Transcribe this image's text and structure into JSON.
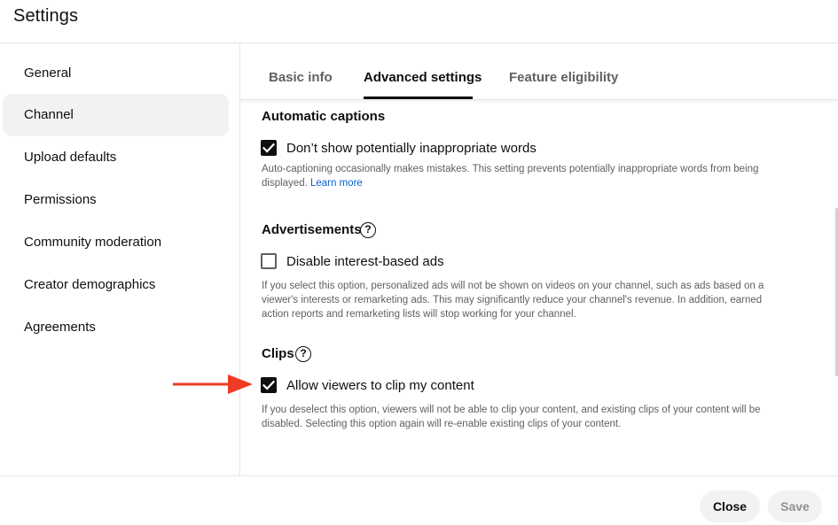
{
  "header": {
    "title": "Settings"
  },
  "sidebar": {
    "items": [
      {
        "label": "General",
        "active": false
      },
      {
        "label": "Channel",
        "active": true
      },
      {
        "label": "Upload defaults",
        "active": false
      },
      {
        "label": "Permissions",
        "active": false
      },
      {
        "label": "Community moderation",
        "active": false
      },
      {
        "label": "Creator demographics",
        "active": false
      },
      {
        "label": "Agreements",
        "active": false
      }
    ]
  },
  "tabs": [
    {
      "label": "Basic info",
      "active": false
    },
    {
      "label": "Advanced settings",
      "active": true
    },
    {
      "label": "Feature eligibility",
      "active": false
    }
  ],
  "captions": {
    "title": "Automatic captions",
    "checkbox_label": "Don’t show potentially inappropriate words",
    "checked": true,
    "description": "Auto-captioning occasionally makes mistakes. This setting prevents potentially inappropriate words from being displayed.",
    "learn_more": "Learn more"
  },
  "ads": {
    "title": "Advertisements",
    "checkbox_label": "Disable interest-based ads",
    "checked": false,
    "description": "If you select this option, personalized ads will not be shown on videos on your channel, such as ads based on a viewer's interests or remarketing ads. This may significantly reduce your channel's revenue. In addition, earned action reports and remarketing lists will stop working for your channel."
  },
  "clips": {
    "title": "Clips",
    "checkbox_label": "Allow viewers to clip my content",
    "checked": true,
    "description": "If you deselect this option, viewers will not be able to clip your content, and existing clips of your content will be disabled. Selecting this option again will re-enable existing clips of your content."
  },
  "help_glyph": "?",
  "footer": {
    "close_label": "Close",
    "save_label": "Save"
  },
  "colors": {
    "annotation_arrow": "#ee3b24",
    "link": "#065fd4",
    "active_nav_bg": "#f2f2f2"
  }
}
